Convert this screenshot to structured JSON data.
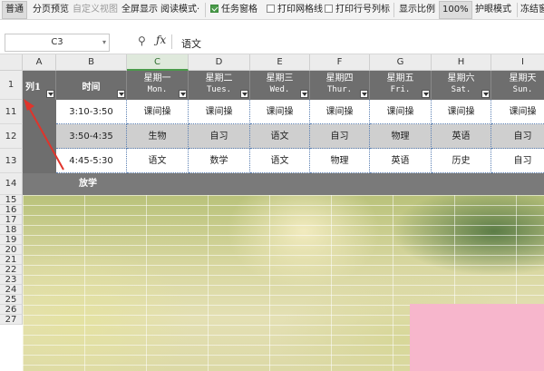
{
  "toolbar": {
    "items": [
      {
        "label": "普通",
        "state": "active"
      },
      {
        "label": "分页预览",
        "state": "normal"
      },
      {
        "label": "自定义视图",
        "state": "disabled"
      },
      {
        "label": "全屏显示",
        "state": "normal"
      },
      {
        "label": "阅读模式·",
        "state": "normal"
      },
      {
        "label": "任务窗格",
        "checked": true
      },
      {
        "label": "打印网格线",
        "checked": false
      },
      {
        "label": "打印行号列标",
        "checked": false
      },
      {
        "label": "显示比例",
        "state": "normal"
      },
      {
        "label": "100%",
        "state": "active"
      },
      {
        "label": "护眼模式",
        "state": "normal"
      },
      {
        "label": "冻结窗",
        "state": "normal"
      }
    ]
  },
  "formula_bar": {
    "name_box": "C3",
    "fx_symbol": "ƒx",
    "value": "语文"
  },
  "columns": [
    "A",
    "B",
    "C",
    "D",
    "E",
    "F",
    "G",
    "H",
    "I"
  ],
  "selected_column": "C",
  "rows": [
    "1",
    "11",
    "12",
    "13",
    "14",
    "15",
    "16",
    "17",
    "18",
    "19",
    "20",
    "21",
    "22",
    "23",
    "24",
    "25",
    "26",
    "27"
  ],
  "table": {
    "header_a": "列1",
    "header_b": "时间",
    "days": [
      {
        "cn": "星期一",
        "en": "Mon."
      },
      {
        "cn": "星期二",
        "en": "Tues."
      },
      {
        "cn": "星期三",
        "en": "Wed."
      },
      {
        "cn": "星期四",
        "en": "Thur."
      },
      {
        "cn": "星期五",
        "en": "Fri."
      },
      {
        "cn": "星期六",
        "en": "Sat."
      },
      {
        "cn": "星期天",
        "en": "Sun."
      }
    ],
    "rows": [
      {
        "time": "3:10-3:50",
        "cells": [
          "课间操",
          "课间操",
          "课间操",
          "课间操",
          "课间操",
          "课间操",
          "课间操"
        ]
      },
      {
        "time": "3:50-4:35",
        "cells": [
          "生物",
          "自习",
          "语文",
          "自习",
          "物理",
          "英语",
          "自习"
        ]
      },
      {
        "time": "4:45-5:30",
        "cells": [
          "语文",
          "数学",
          "语文",
          "物理",
          "英语",
          "历史",
          "自习"
        ]
      }
    ],
    "end_label": "放学"
  },
  "colors": {
    "header_bg": "#6e6e6e",
    "band_bg": "#7a7a7a",
    "gray_row": "#cfcfcf",
    "accent_green": "#4a9a4a",
    "annotation_red": "#e0342b"
  }
}
